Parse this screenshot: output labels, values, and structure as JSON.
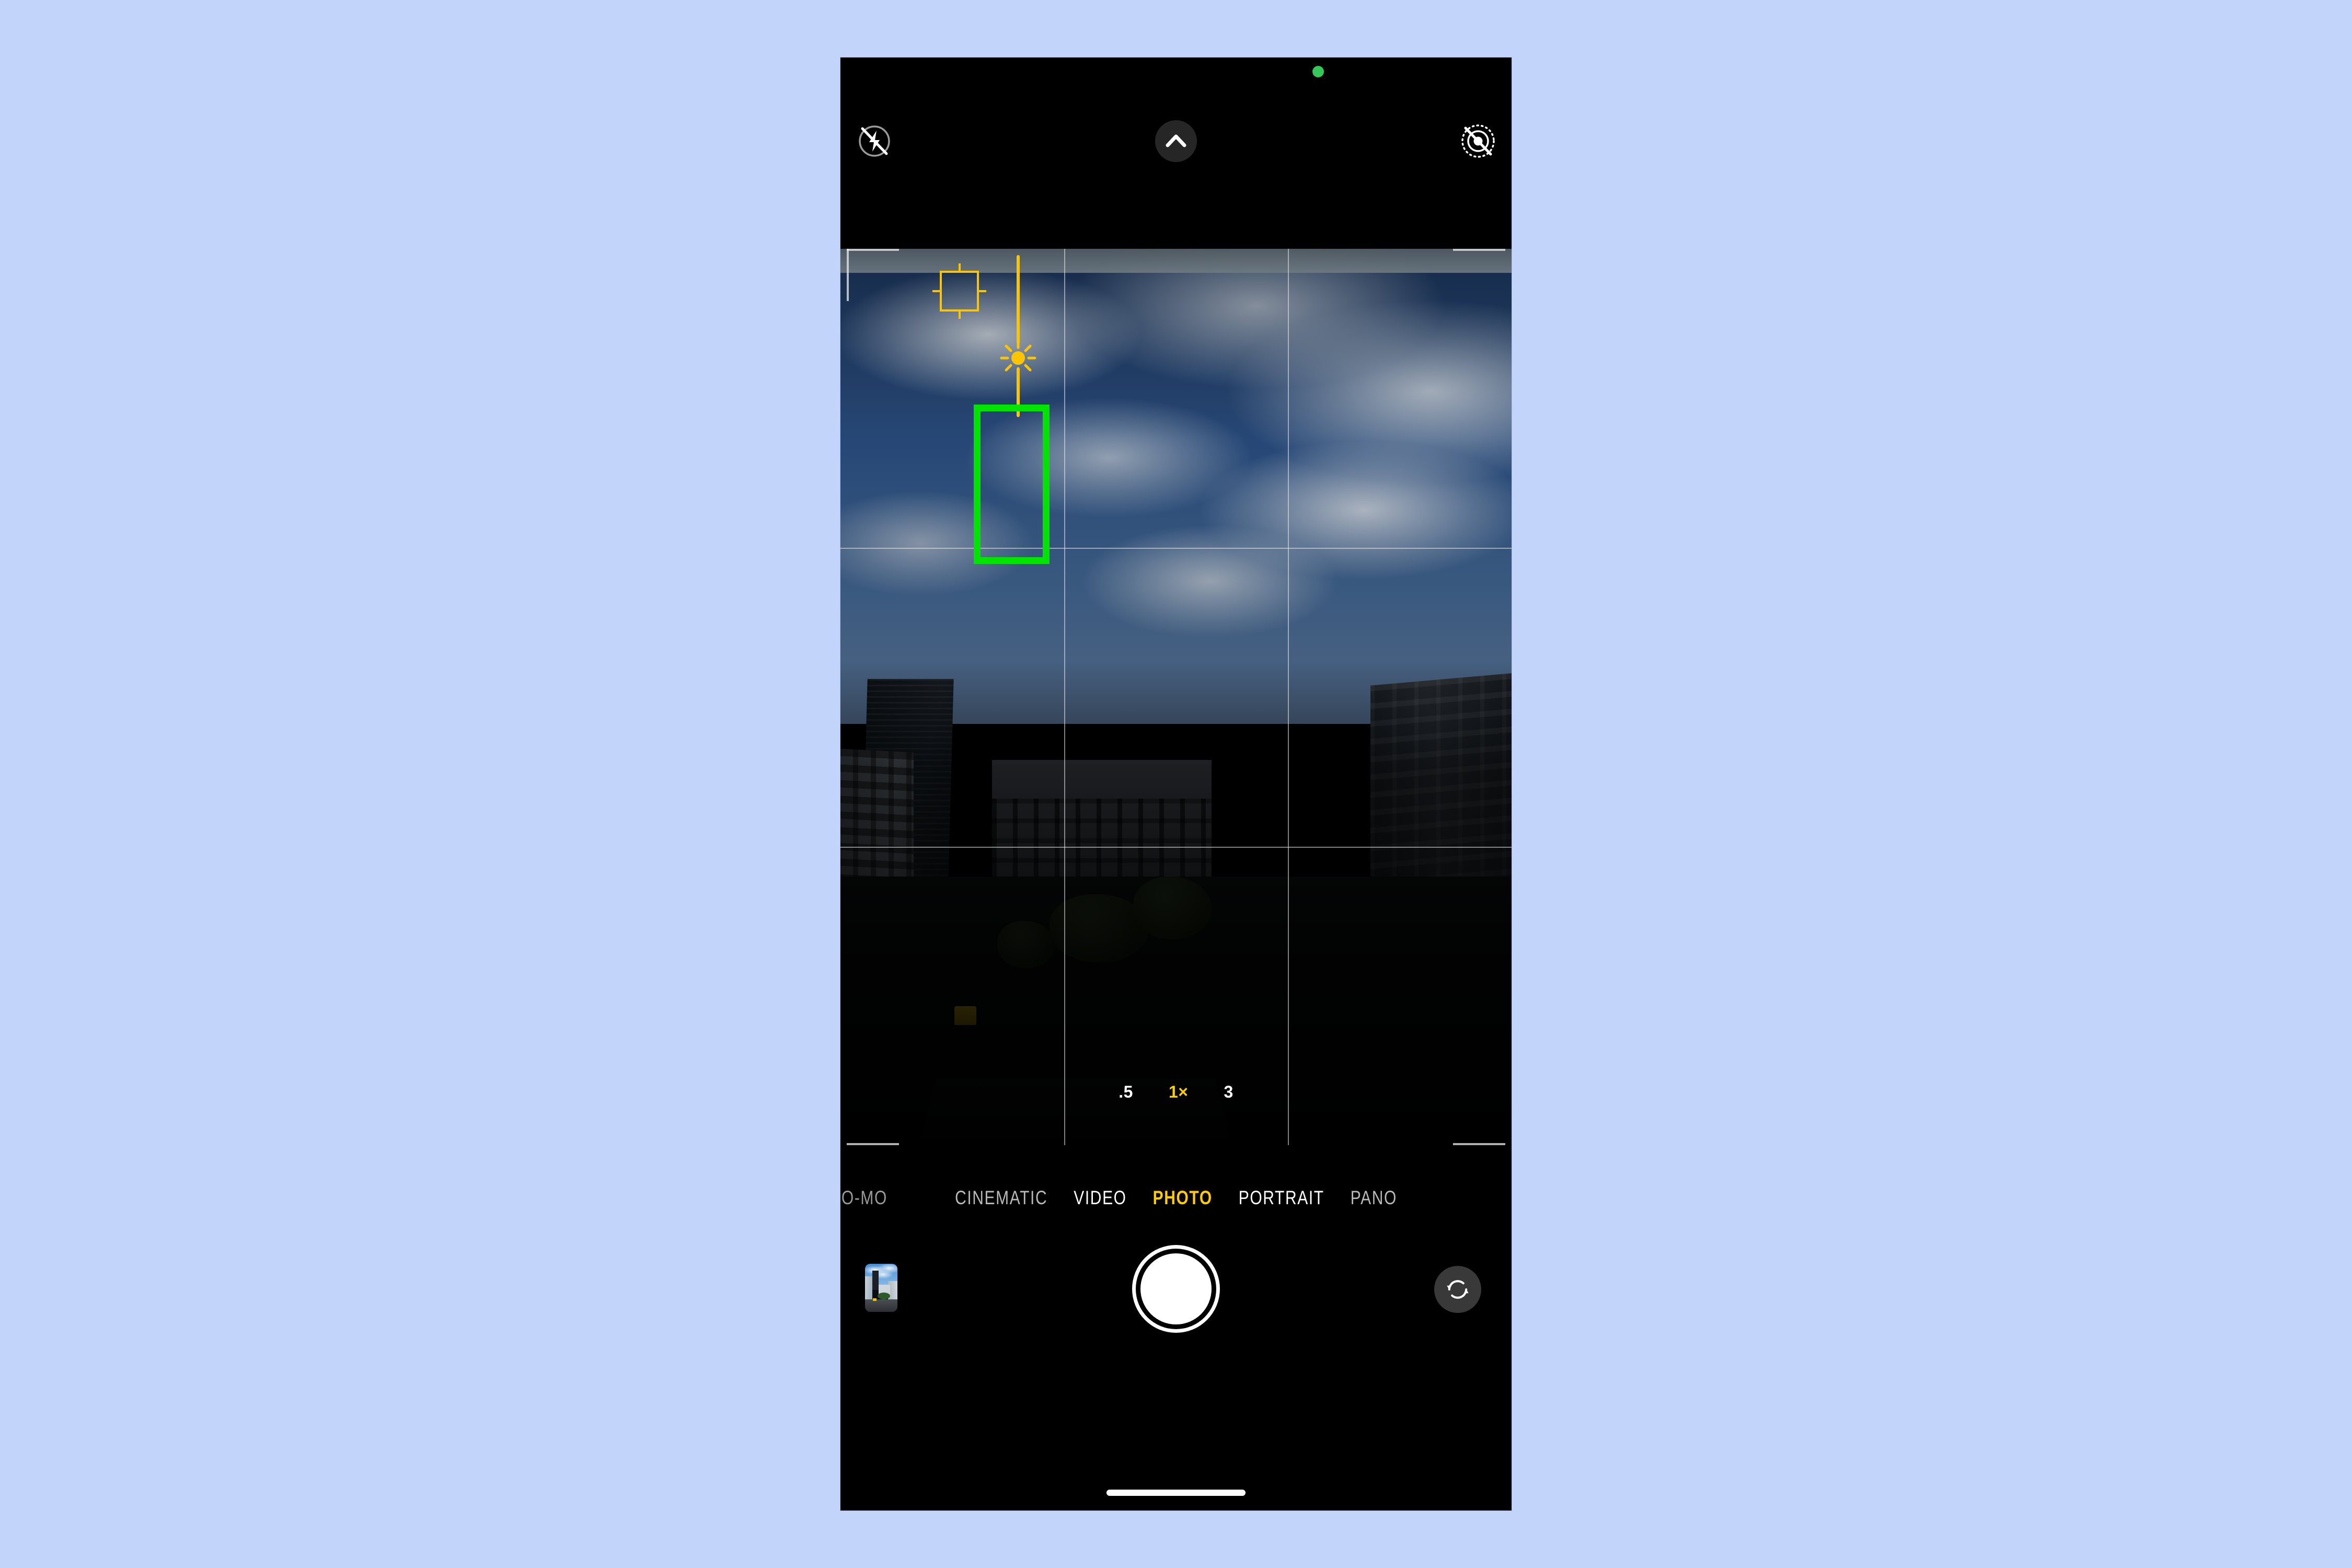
{
  "app": {
    "name": "Camera",
    "platform": "iOS"
  },
  "status": {
    "privacy_indicator": "camera-active",
    "privacy_indicator_color": "#34c759"
  },
  "top_bar": {
    "flash": {
      "icon": "flash-off-icon",
      "label": "Flash Off",
      "state": "off"
    },
    "expand": {
      "icon": "chevron-up-icon",
      "label": "More Controls"
    },
    "live_photo": {
      "icon": "live-photo-off-icon",
      "label": "Live Photo Off",
      "state": "off"
    }
  },
  "viewfinder": {
    "grid": {
      "enabled": true,
      "type": "rule-of-thirds",
      "color": "#ebebeb"
    },
    "scene_description": "City street view from above with blue sky, cumulus clouds, dark tower block and white terraced buildings",
    "focus_reticle": {
      "name": "af-focus-box",
      "color": "#ffc400",
      "state": "locked"
    },
    "exposure_slider": {
      "name": "exposure-slider",
      "color": "#ffc400",
      "icon": "sun-icon",
      "state": "dragged-down",
      "effect": "exposure reduced"
    },
    "annotation": {
      "name": "green-highlight-box",
      "color": "#00e400",
      "target": "exposure-slider"
    }
  },
  "zoom": {
    "options": [
      {
        "label": ".5",
        "value": 0.5,
        "active": false
      },
      {
        "label": "1×",
        "value": 1,
        "active": true
      },
      {
        "label": "3",
        "value": 3,
        "active": false
      }
    ],
    "selected": "1×",
    "active_color": "#ffcc00"
  },
  "modes": {
    "items": [
      {
        "label": "SLO-MO",
        "active": false,
        "cut_off": true
      },
      {
        "label": "CINEMATIC",
        "active": false
      },
      {
        "label": "VIDEO",
        "active": false
      },
      {
        "label": "PHOTO",
        "active": true
      },
      {
        "label": "PORTRAIT",
        "active": false
      },
      {
        "label": "PANO",
        "active": false
      }
    ],
    "selected": "PHOTO",
    "active_color": "#ffcc00"
  },
  "bottom_bar": {
    "thumbnail": {
      "name": "photo-thumbnail",
      "label": "Last Photo"
    },
    "shutter": {
      "name": "shutter-button",
      "label": "Take Photo"
    },
    "flip": {
      "name": "camera-flip-button",
      "icon": "camera-flip-icon",
      "label": "Switch Camera"
    }
  },
  "system": {
    "home_indicator": "home-indicator"
  },
  "colors": {
    "background": "#c3d4fa",
    "accent_yellow": "#ffcc00",
    "annotation_green": "#00e400",
    "reticle_yellow": "#ffc400"
  }
}
